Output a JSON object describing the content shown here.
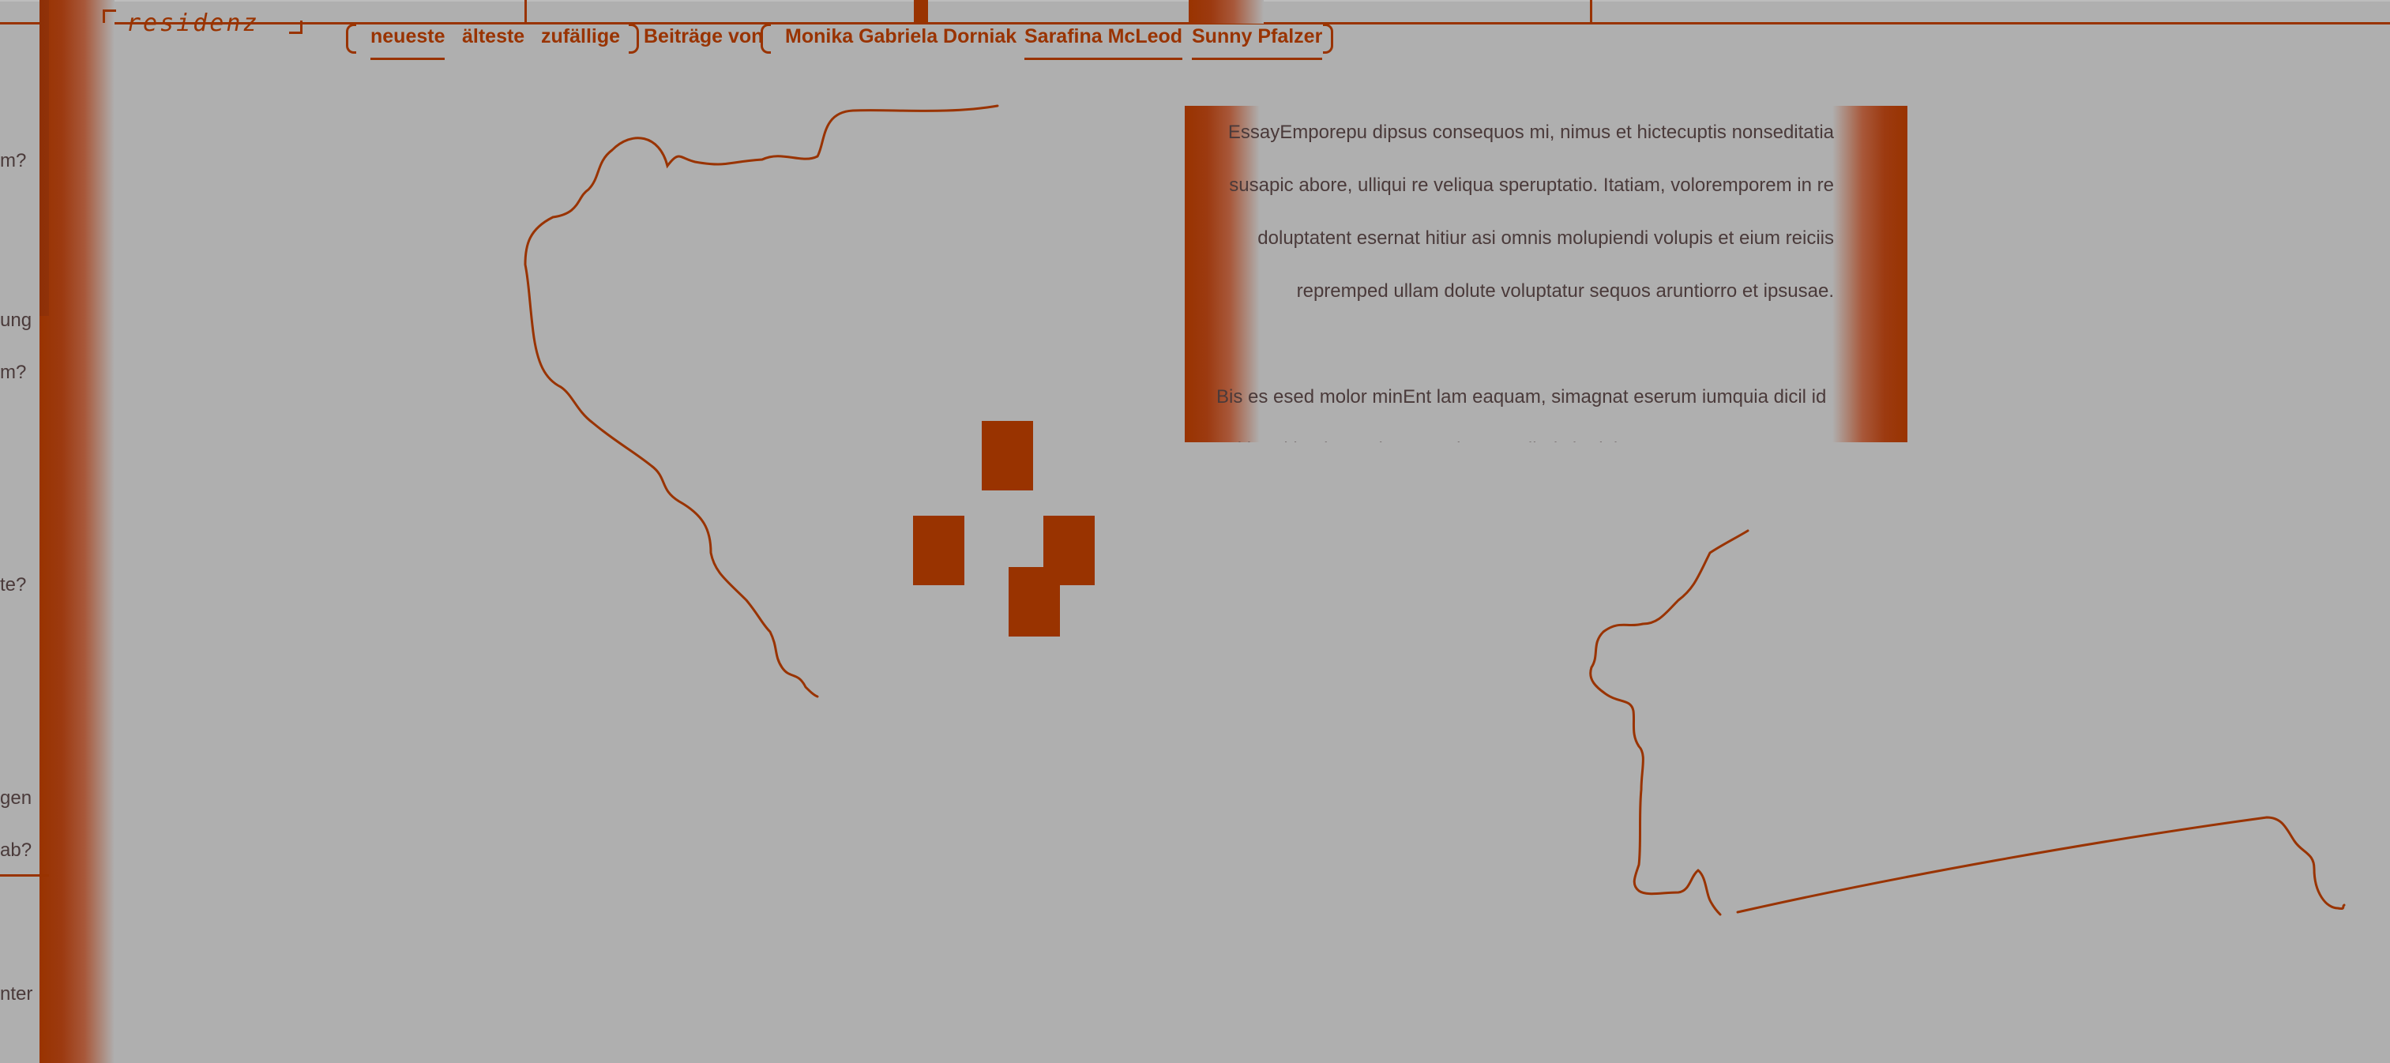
{
  "brand": {
    "logo": "residenz"
  },
  "colors": {
    "accent": "#993300",
    "background": "#afafaf",
    "text": "#4a3a3a"
  },
  "nav": {
    "sort_items": [
      "neueste",
      "älteste",
      "zufällige"
    ],
    "contributors_label": "Beiträge von",
    "authors": [
      "Monika Gabriela Dorniak",
      "Sarafina McLeod",
      "Sunny Pfalzer"
    ]
  },
  "sidebar": {
    "items": [
      "m?",
      "ung",
      "m?",
      "te?",
      "gen",
      "ab?",
      "nter"
    ]
  },
  "article": {
    "paragraph1": "EssayEmporepu dipsus consequos mi, nimus et hictecuptis nonseditatia susapic abore, ulliqui re veliqua speruptatio. Itatiam, voloremporem in re doluptatent esernat hitiur asi omnis molupiendi volupis et eium reiciis repremped ullam dolute voluptatur sequos aruntiorro et ipsusae.",
    "paragraph2": "Bis es esed molor minEnt lam eaquam, simagnat eserum iumquia dicil id qui beati iuntisto voluptatem incte molloristia dolora cus et"
  }
}
